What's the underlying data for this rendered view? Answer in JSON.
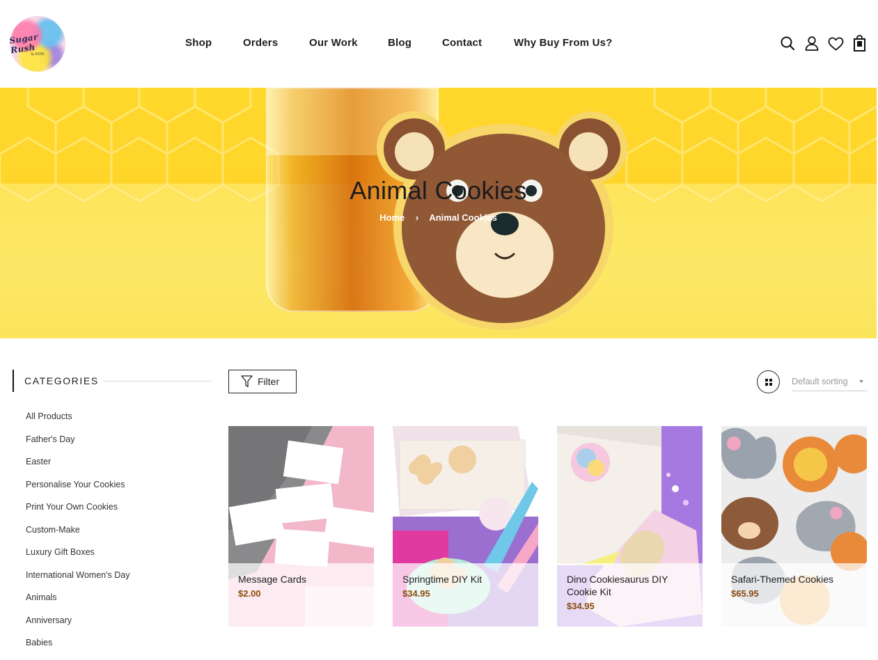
{
  "header": {
    "logo_text": "Sugar Rush",
    "logo_sub": "by ESTER",
    "nav": [
      "Shop",
      "Orders",
      "Our Work",
      "Blog",
      "Contact",
      "Why Buy From Us?"
    ],
    "icons": [
      "search-icon",
      "account-icon",
      "wishlist-heart-icon",
      "cart-bag-icon"
    ]
  },
  "hero": {
    "title": "Animal Cookies",
    "breadcrumb": {
      "home": "Home",
      "separator": "›",
      "current": "Animal Cookies"
    }
  },
  "sidebar": {
    "title": "CATEGORIES",
    "items": [
      "All Products",
      "Father's Day",
      "Easter",
      "Personalise Your Cookies",
      "Print Your Own Cookies",
      "Custom-Make",
      "Luxury Gift Boxes",
      "International Women's Day",
      "Animals",
      "Anniversary",
      "Babies"
    ]
  },
  "toolbar": {
    "filter_label": "Filter",
    "sort_label": "Default sorting"
  },
  "products": [
    {
      "name": "Message Cards",
      "price": "$2.00"
    },
    {
      "name": "Springtime DIY Kit",
      "price": "$34.95"
    },
    {
      "name": "Dino Cookiesaurus DIY Cookie Kit",
      "price": "$34.95"
    },
    {
      "name": "Safari-Themed Cookies",
      "price": "$65.95"
    }
  ],
  "colors": {
    "price": "#8a4b0c",
    "hero_yellow": "#ffd82c",
    "text": "#1d1d1d"
  }
}
